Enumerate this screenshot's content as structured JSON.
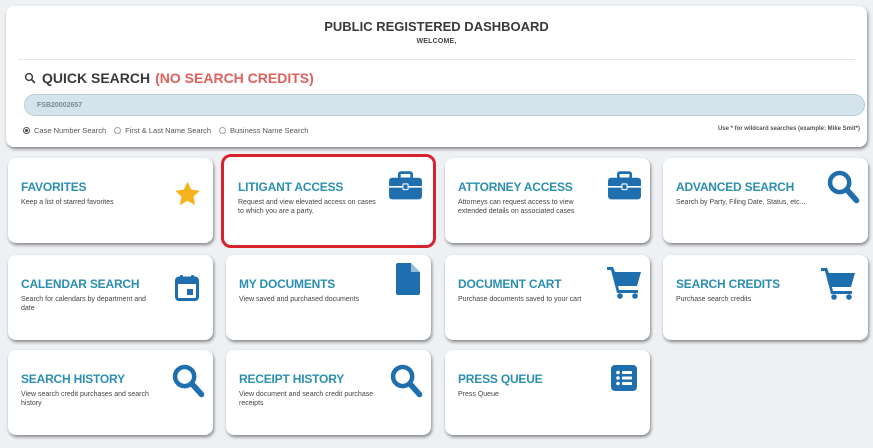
{
  "header": {
    "title": "PUBLIC REGISTERED DASHBOARD",
    "welcome": "WELCOME,"
  },
  "quick_search": {
    "icon": "search-icon",
    "title": "QUICK SEARCH",
    "credits": "(NO SEARCH CREDITS)",
    "input_value": "FSB20002657",
    "options": [
      {
        "label": "Case Number Search",
        "selected": true
      },
      {
        "label": "First & Last Name Search",
        "selected": false
      },
      {
        "label": "Business Name Search",
        "selected": false
      }
    ],
    "wildcard_note": "Use * for wildcard searches (example: Mike Smit*)"
  },
  "tiles": [
    {
      "title": "FAVORITES",
      "desc": "Keep a list of starred favorites",
      "icon": "star-icon"
    },
    {
      "title": "LITIGANT ACCESS",
      "desc": "Request and view elevated access on cases to which you are a party.",
      "icon": "briefcase-icon"
    },
    {
      "title": "ATTORNEY ACCESS",
      "desc": "Attorneys can request access to view extended details on associated cases",
      "icon": "briefcase-icon"
    },
    {
      "title": "ADVANCED SEARCH",
      "desc": "Search by Party, Filing Date, Status, etc...",
      "icon": "search-icon"
    },
    {
      "title": "CALENDAR SEARCH",
      "desc": "Search for calendars by department and date",
      "icon": "calendar-icon"
    },
    {
      "title": "MY DOCUMENTS",
      "desc": "View saved and purchased documents",
      "icon": "document-icon"
    },
    {
      "title": "DOCUMENT CART",
      "desc": "Purchase documents saved to your cart",
      "icon": "cart-icon"
    },
    {
      "title": "SEARCH CREDITS",
      "desc": "Purchase search credits",
      "icon": "cart-icon"
    },
    {
      "title": "SEARCH HISTORY",
      "desc": "View search credit purchases and search history",
      "icon": "search-icon"
    },
    {
      "title": "RECEIPT HISTORY",
      "desc": "View document and search credit purchase receipts",
      "icon": "search-icon"
    },
    {
      "title": "PRESS QUEUE",
      "desc": "Press Queue",
      "icon": "list-icon"
    }
  ],
  "colors": {
    "accent": "#2b8fb1",
    "icon_blue": "#1f6fae",
    "star": "#f5b21b",
    "credits_red": "#e0605c",
    "highlight": "#d9232c"
  }
}
